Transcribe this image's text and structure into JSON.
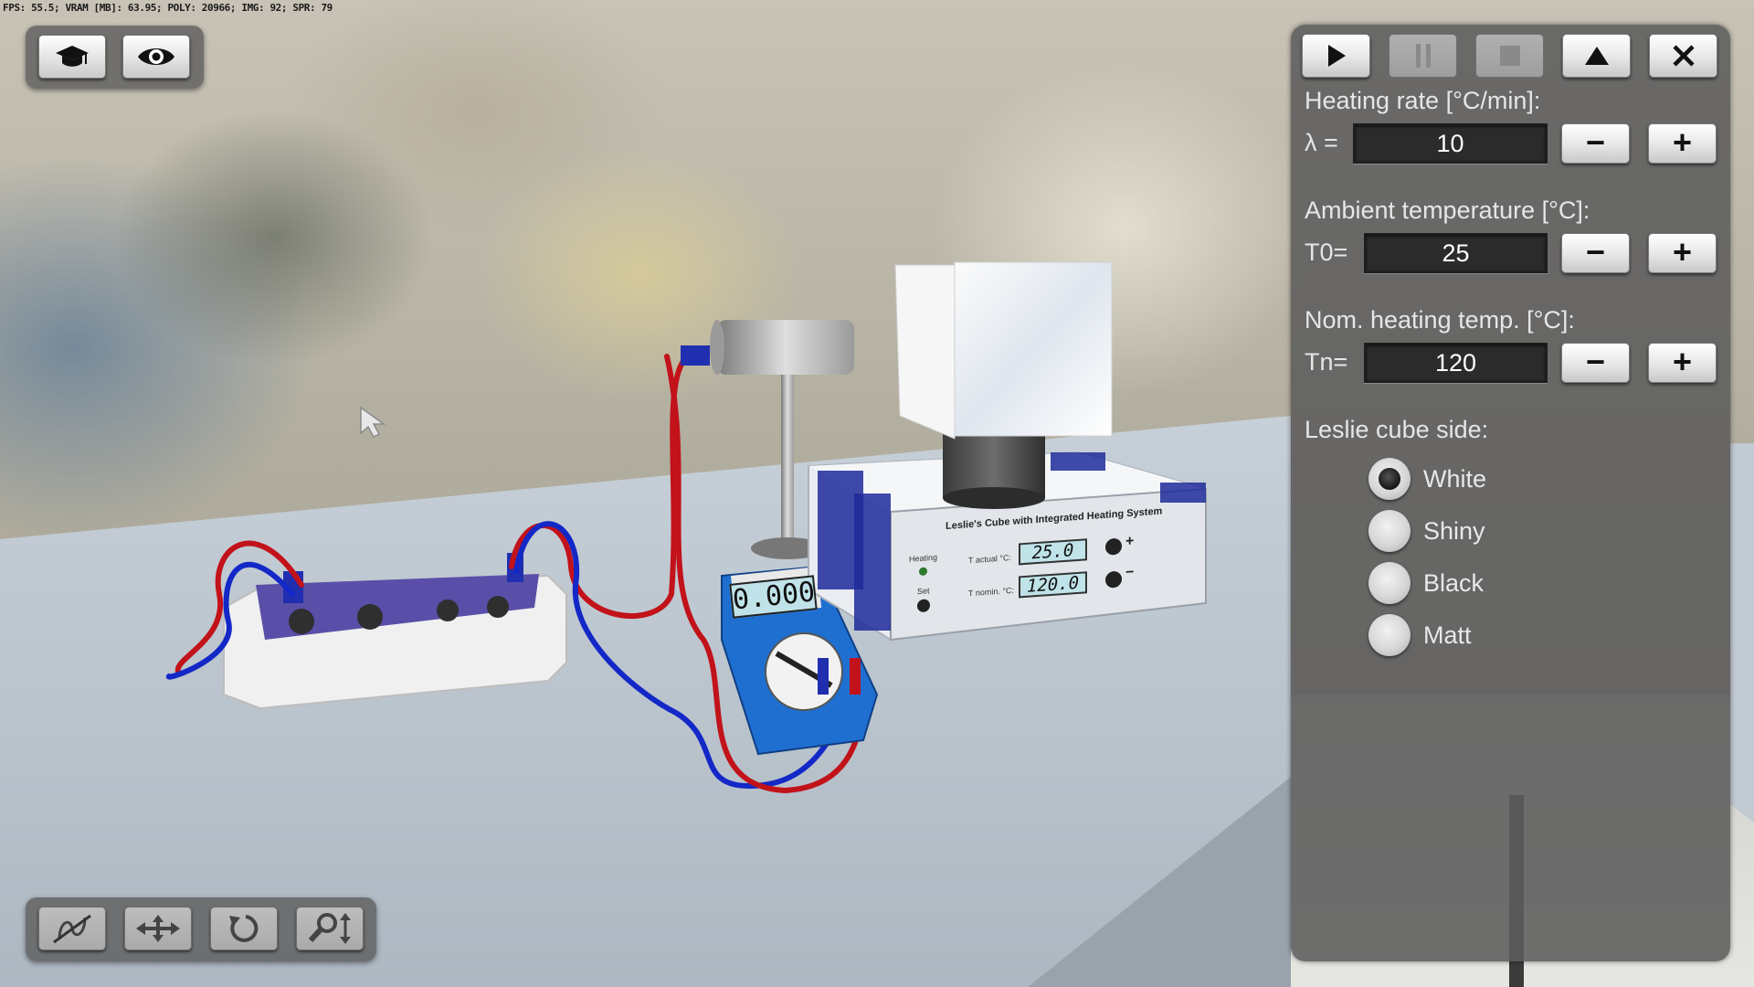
{
  "debug_text": "FPS: 55.5; VRAM [MB]: 63.95; POLY: 20966; IMG: 92; SPR: 79",
  "top_toolbar": {
    "buttons": [
      {
        "icon": "graduation-cap-icon"
      },
      {
        "icon": "eye-icon"
      }
    ]
  },
  "bottom_toolbar": {
    "buttons": [
      {
        "icon": "cable-toggle-icon"
      },
      {
        "icon": "move-icon"
      },
      {
        "icon": "rotate-icon"
      },
      {
        "icon": "zoom-icon"
      }
    ]
  },
  "panel": {
    "controls": [
      {
        "icon": "play-icon",
        "enabled": true
      },
      {
        "icon": "pause-icon",
        "enabled": false
      },
      {
        "icon": "stop-icon",
        "enabled": false
      },
      {
        "icon": "collapse-up-icon",
        "enabled": true
      },
      {
        "icon": "close-icon",
        "enabled": true
      }
    ],
    "heating_rate": {
      "label": "Heating rate [°C/min]:",
      "var": "λ =",
      "value": "10"
    },
    "ambient": {
      "label": "Ambient temperature [°C]:",
      "var": "T0=",
      "value": "25"
    },
    "nominal": {
      "label": "Nom. heating temp. [°C]:",
      "var": "Tn=",
      "value": "120"
    },
    "minus_label": "−",
    "plus_label": "+",
    "cube_side": {
      "label": "Leslie cube side:",
      "options": [
        "White",
        "Shiny",
        "Black",
        "Matt"
      ],
      "selected": "White"
    }
  },
  "device": {
    "title": "Leslie's Cube with Integrated Heating System",
    "heating_label": "Heating",
    "set_label": "Set",
    "t_actual_label": "T actual °C:",
    "t_actual_value": "25.0",
    "t_nomin_label": "T nomin. °C:",
    "t_nomin_value": "120.0",
    "plus": "+",
    "minus": "−"
  },
  "multimeter": {
    "display": "0.000"
  }
}
